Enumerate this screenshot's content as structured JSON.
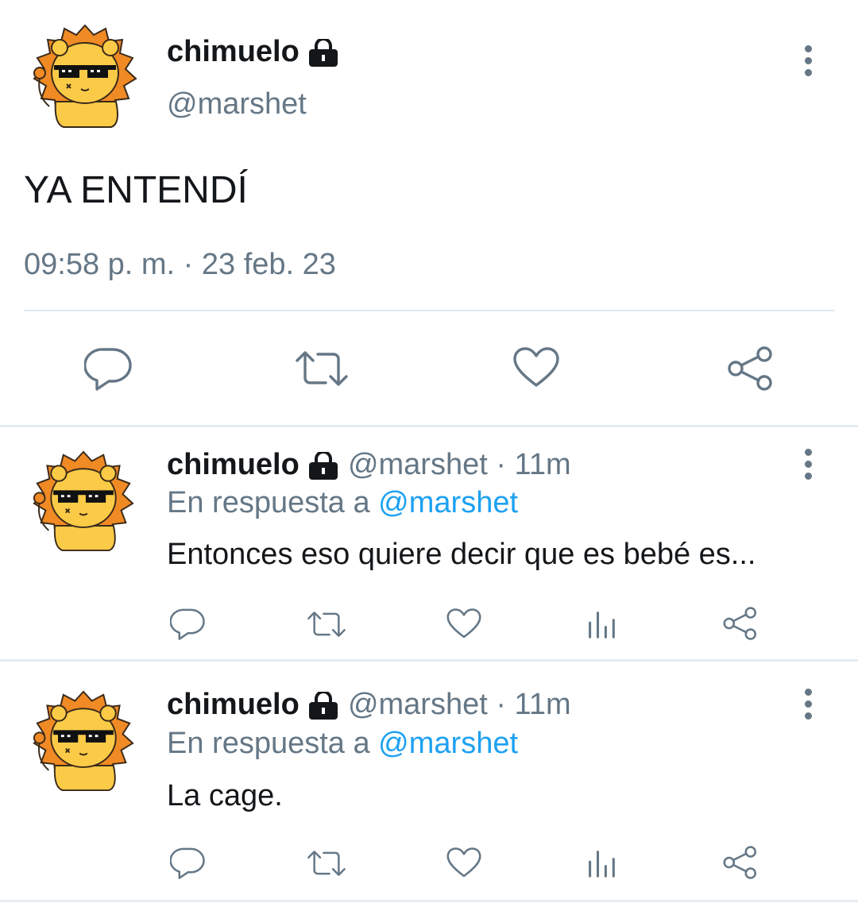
{
  "main_tweet": {
    "display_name": "chimuelo",
    "handle": "@marshet",
    "text": "YA ENTENDÍ",
    "timestamp": "09:58 p. m. · 23 feb. 23",
    "actions": [
      "reply-icon",
      "retweet-icon",
      "like-icon",
      "share-icon"
    ]
  },
  "replies": [
    {
      "display_name": "chimuelo",
      "handle_time": "@marshet · 11m",
      "reply_prefix": "En respuesta a",
      "reply_to": "@marshet",
      "text": "Entonces eso quiere decir que es bebé es..."
    },
    {
      "display_name": "chimuelo",
      "handle_time": "@marshet · 11m",
      "reply_prefix": "En respuesta a",
      "reply_to": "@marshet",
      "text": "La cage."
    }
  ],
  "colors": {
    "text": "#14171a",
    "muted": "#657786",
    "link": "#1da1f2",
    "avatar_mane": "#f08a24",
    "avatar_face": "#fbcb47"
  }
}
